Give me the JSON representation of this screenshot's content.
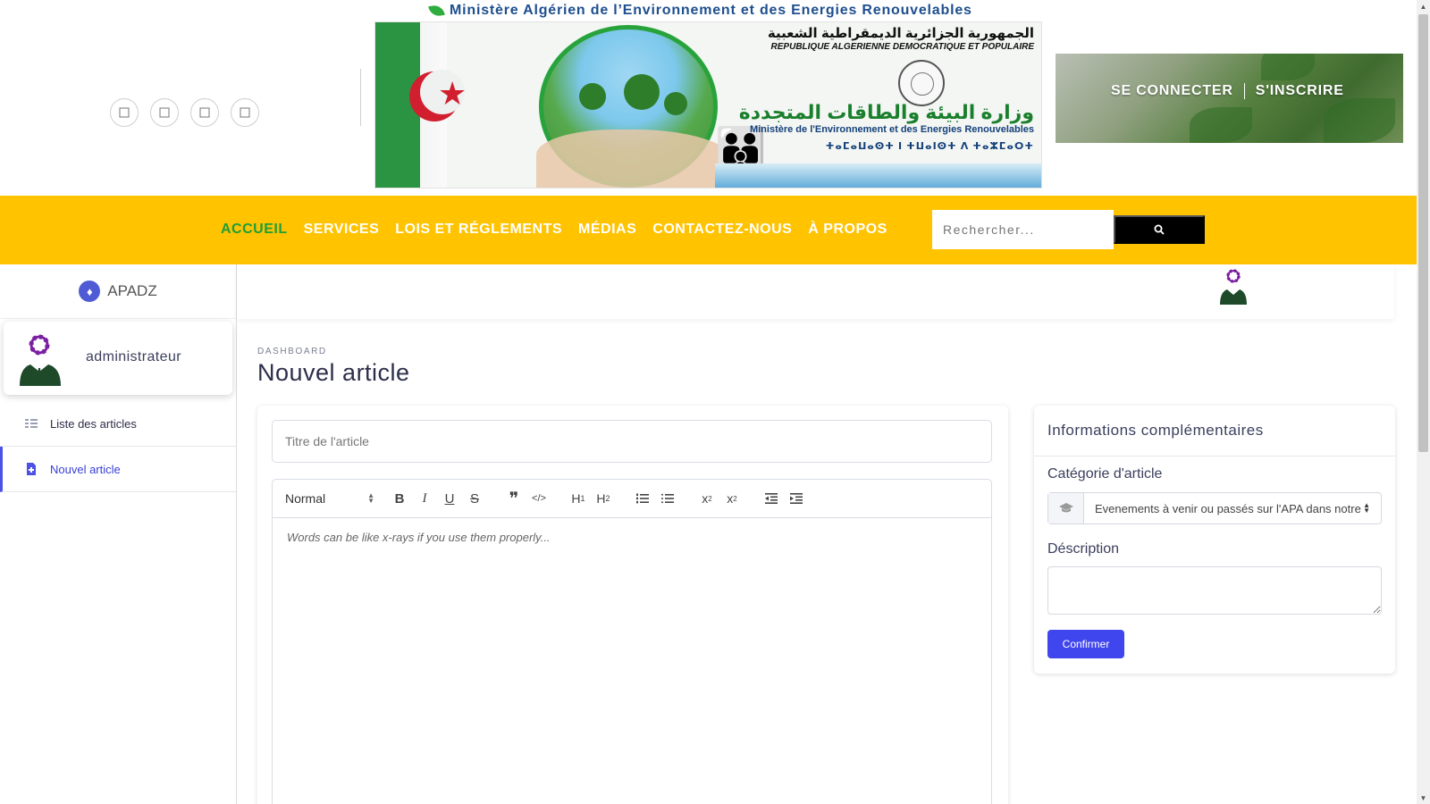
{
  "header": {
    "ministry_title": "Ministère Algérien de l’Environnement et des Energies Renouvelables",
    "banner": {
      "arabic_republic": "الجمهورية الجزائرية الديمقراطية الشعبية",
      "french_republic": "REPUBLIQUE ALGERIENNE DEMOCRATIQUE ET POPULAIRE",
      "arabic_ministry": "وزارة البيئة والطاقات المتجددة",
      "french_ministry": "Ministère de l'Environnement et des Energies Renouvelables",
      "tifinagh_ministry": "ⵜⴰⵎⴰⵡⴰⵙⵜ ⵏ ⵜⵡⴰⵏⵙⵜ ⴷ ⵜⴰⵣⵎⴰⵔⵜ"
    },
    "social_icons": [
      "facebook-icon",
      "twitter-icon",
      "instagram-icon",
      "youtube-icon"
    ],
    "auth": {
      "login": "SE CONNECTER",
      "register": "S'INSCRIRE"
    }
  },
  "nav": {
    "items": [
      "ACCUEIL",
      "SERVICES",
      "LOIS ET RÉGLEMENTS",
      "MÉDIAS",
      "CONTACTEZ-NOUS",
      "À PROPOS"
    ],
    "active_index": 0,
    "search_placeholder": "Rechercher..."
  },
  "sidebar": {
    "brand": "APADZ",
    "user_name": "administrateur",
    "menu": [
      {
        "label": "Liste des articles",
        "icon": "list-icon",
        "active": false
      },
      {
        "label": "Nouvel article",
        "icon": "file-plus-icon",
        "active": true
      }
    ]
  },
  "main": {
    "breadcrumb": "DASHBOARD",
    "title": "Nouvel article",
    "editor": {
      "title_placeholder": "Titre de l'article",
      "format_select": "Normal",
      "body_placeholder": "Words can be like x-rays if you use them properly..."
    },
    "info": {
      "heading": "Informations complémentaires",
      "category_label": "Catégorie d'article",
      "category_value": "Evenements à venir ou passés sur l'APA dans notre pays",
      "description_label": "Déscription",
      "confirm": "Confirmer"
    }
  },
  "colors": {
    "nav_bg": "#ffc300",
    "nav_active": "#1f9e3a",
    "accent": "#4046ee",
    "ministry_title": "#1e4f8f",
    "user_icon_gear": "#7a1fa2"
  }
}
